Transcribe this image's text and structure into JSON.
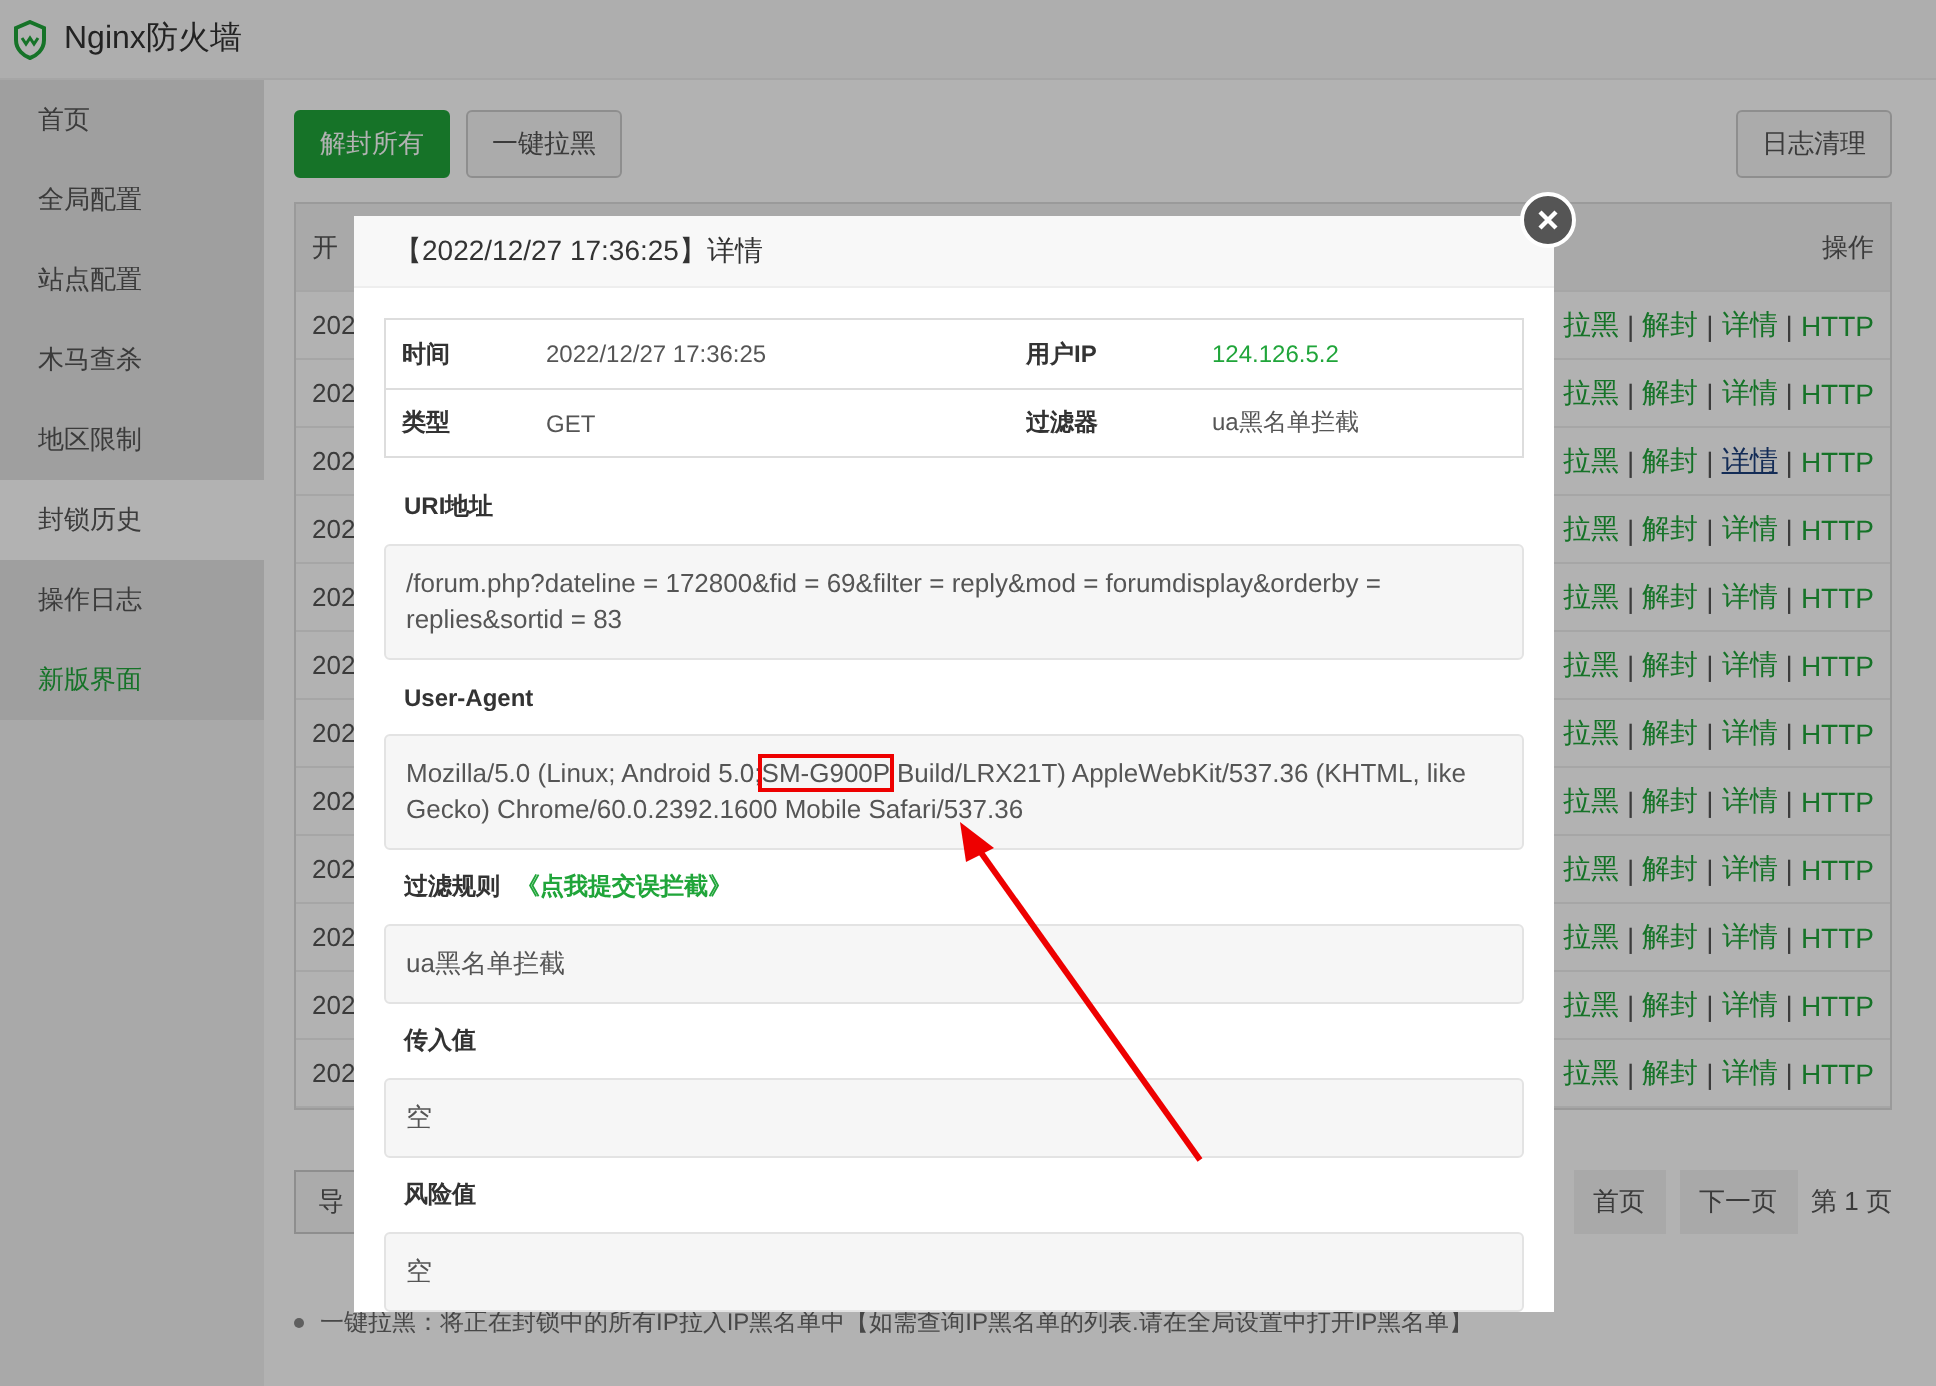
{
  "app": {
    "title": "Nginx防火墙"
  },
  "sidebar": {
    "items": [
      {
        "label": "首页",
        "selected": false,
        "kind": "page"
      },
      {
        "label": "全局配置",
        "selected": false,
        "kind": "page"
      },
      {
        "label": "站点配置",
        "selected": false,
        "kind": "page"
      },
      {
        "label": "木马查杀",
        "selected": false,
        "kind": "page"
      },
      {
        "label": "地区限制",
        "selected": false,
        "kind": "page"
      },
      {
        "label": "封锁历史",
        "selected": true,
        "kind": "page"
      },
      {
        "label": "操作日志",
        "selected": false,
        "kind": "page"
      },
      {
        "label": "新版界面",
        "selected": false,
        "kind": "link"
      }
    ]
  },
  "toolbar": {
    "buttons": [
      {
        "label": "解封所有",
        "kind": "primary"
      },
      {
        "label": "一键拉黑",
        "kind": "default"
      }
    ],
    "right_button": "日志清理"
  },
  "table": {
    "columns": [
      "开",
      "操作"
    ],
    "separator": "|",
    "rows": [
      {
        "date": "202",
        "actions": [
          {
            "label": "拉黑",
            "hovered": false
          },
          {
            "label": "解封",
            "hovered": false
          },
          {
            "label": "详情",
            "hovered": false
          },
          {
            "label": "HTTP",
            "hovered": false
          }
        ]
      },
      {
        "date": "202",
        "actions": [
          {
            "label": "拉黑",
            "hovered": false
          },
          {
            "label": "解封",
            "hovered": false
          },
          {
            "label": "详情",
            "hovered": false
          },
          {
            "label": "HTTP",
            "hovered": false
          }
        ]
      },
      {
        "date": "202",
        "actions": [
          {
            "label": "拉黑",
            "hovered": false
          },
          {
            "label": "解封",
            "hovered": false
          },
          {
            "label": "详情",
            "hovered": true
          },
          {
            "label": "HTTP",
            "hovered": false
          }
        ]
      },
      {
        "date": "202",
        "actions": [
          {
            "label": "拉黑",
            "hovered": false
          },
          {
            "label": "解封",
            "hovered": false
          },
          {
            "label": "详情",
            "hovered": false
          },
          {
            "label": "HTTP",
            "hovered": false
          }
        ]
      },
      {
        "date": "202",
        "actions": [
          {
            "label": "拉黑",
            "hovered": false
          },
          {
            "label": "解封",
            "hovered": false
          },
          {
            "label": "详情",
            "hovered": false
          },
          {
            "label": "HTTP",
            "hovered": false
          }
        ]
      },
      {
        "date": "202",
        "actions": [
          {
            "label": "拉黑",
            "hovered": false
          },
          {
            "label": "解封",
            "hovered": false
          },
          {
            "label": "详情",
            "hovered": false
          },
          {
            "label": "HTTP",
            "hovered": false
          }
        ]
      },
      {
        "date": "202",
        "actions": [
          {
            "label": "拉黑",
            "hovered": false
          },
          {
            "label": "解封",
            "hovered": false
          },
          {
            "label": "详情",
            "hovered": false
          },
          {
            "label": "HTTP",
            "hovered": false
          }
        ]
      },
      {
        "date": "202",
        "actions": [
          {
            "label": "拉黑",
            "hovered": false
          },
          {
            "label": "解封",
            "hovered": false
          },
          {
            "label": "详情",
            "hovered": false
          },
          {
            "label": "HTTP",
            "hovered": false
          }
        ]
      },
      {
        "date": "202",
        "actions": [
          {
            "label": "拉黑",
            "hovered": false
          },
          {
            "label": "解封",
            "hovered": false
          },
          {
            "label": "详情",
            "hovered": false
          },
          {
            "label": "HTTP",
            "hovered": false
          }
        ]
      },
      {
        "date": "202",
        "actions": [
          {
            "label": "拉黑",
            "hovered": false
          },
          {
            "label": "解封",
            "hovered": false
          },
          {
            "label": "详情",
            "hovered": false
          },
          {
            "label": "HTTP",
            "hovered": false
          }
        ]
      },
      {
        "date": "202",
        "actions": [
          {
            "label": "拉黑",
            "hovered": false
          },
          {
            "label": "解封",
            "hovered": false
          },
          {
            "label": "详情",
            "hovered": false
          },
          {
            "label": "HTTP",
            "hovered": false
          }
        ]
      },
      {
        "date": "202",
        "actions": [
          {
            "label": "拉黑",
            "hovered": false
          },
          {
            "label": "解封",
            "hovered": false
          },
          {
            "label": "详情",
            "hovered": false
          },
          {
            "label": "HTTP",
            "hovered": false
          }
        ]
      }
    ]
  },
  "footer": {
    "export_button": "导",
    "pagination": [
      {
        "label": "首页",
        "kind": "button"
      },
      {
        "label": "下一页",
        "kind": "button"
      },
      {
        "label": "第 1 页",
        "kind": "text"
      }
    ],
    "note": "一键拉黑：将正在封锁中的所有IP拉入IP黑名单中【如需查询IP黑名单的列表.请在全局设置中打开IP黑名单】"
  },
  "dialog": {
    "title": "【2022/12/27 17:36:25】详情",
    "info": [
      {
        "label": "时间",
        "value": "2022/12/27 17:36:25",
        "label2": "用户IP",
        "value2": "124.126.5.2"
      },
      {
        "label": "类型",
        "value": "GET",
        "label2": "过滤器",
        "value2": "ua黑名单拦截"
      }
    ],
    "uri_label": "URI地址",
    "uri": "/forum.php?dateline = 172800&fid = 69&filter = reply&mod = forumdisplay&orderby = replies&sortid = 83",
    "ua_label": "User-Agent",
    "ua_before": "Mozilla/5.0 (Linux; Android 5.0;",
    "ua_highlight": "SM-G900P",
    "ua_after": " Build/LRX21T) AppleWebKit/537.36 (KHTML, like Gecko) Chrome/60.0.2392.1600 Mobile Safari/537.36",
    "rule_label": "过滤规则",
    "rule_link": "《点我提交误拦截》",
    "rule": "ua黑名单拦截",
    "input_label": "传入值",
    "input": "空",
    "risk_label": "风险值",
    "risk": "空"
  }
}
